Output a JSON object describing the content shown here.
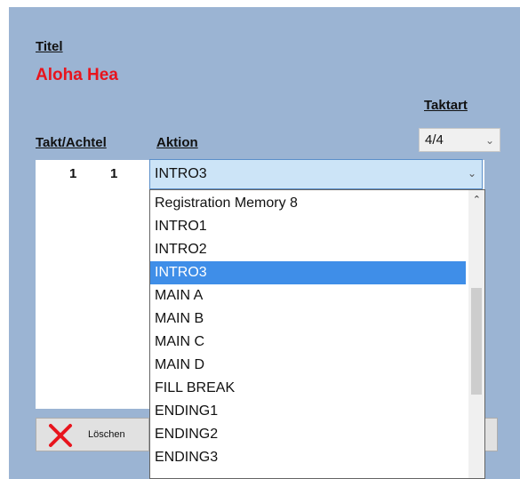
{
  "header": {
    "title_label": "Titel",
    "song_title": "Aloha Hea"
  },
  "taktart": {
    "label": "Taktart",
    "value": "4/4"
  },
  "columns": {
    "takt_achtel": "Takt/Achtel",
    "aktion": "Aktion"
  },
  "row": {
    "takt": "1",
    "achtel": "1",
    "aktion": "INTRO3"
  },
  "dropdown": {
    "selected": "INTRO3",
    "options": [
      "Registration Memory 8",
      "INTRO1",
      "INTRO2",
      "INTRO3",
      "MAIN A",
      "MAIN B",
      "MAIN C",
      "MAIN D",
      "FILL BREAK",
      "ENDING1",
      "ENDING2",
      "ENDING3"
    ]
  },
  "buttons": {
    "delete_label": "Löschen"
  },
  "colors": {
    "panel": "#9bb4d3",
    "title_red": "#e8141d",
    "selection": "#3f8ee8"
  }
}
